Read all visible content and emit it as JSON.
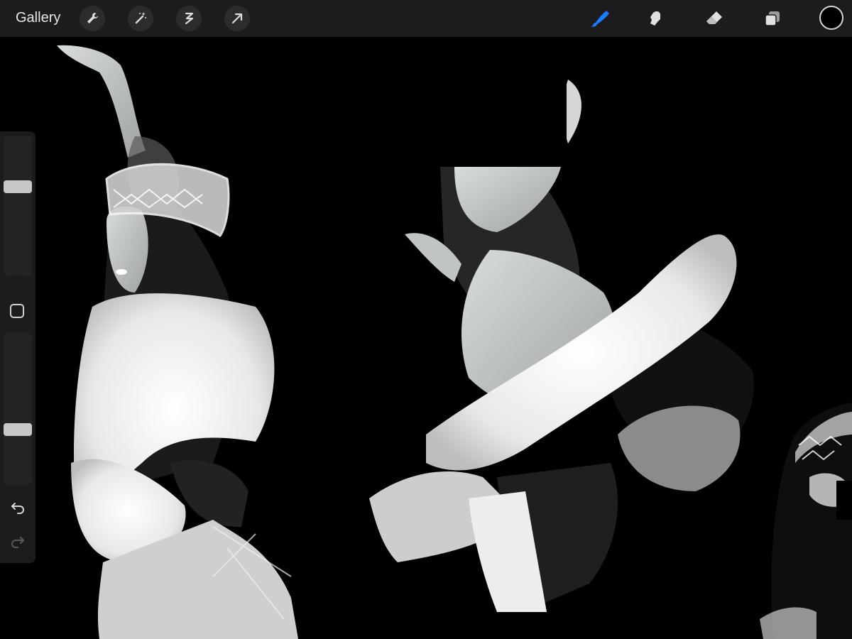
{
  "topbar": {
    "gallery_label": "Gallery",
    "left_tools": [
      {
        "name": "actions-wrench-icon"
      },
      {
        "name": "adjustments-magic-wand-icon"
      },
      {
        "name": "selection-icon"
      },
      {
        "name": "transform-arrow-icon"
      }
    ],
    "right_tools": [
      {
        "name": "brush-icon",
        "active": true
      },
      {
        "name": "smudge-icon"
      },
      {
        "name": "eraser-icon"
      },
      {
        "name": "layers-icon"
      }
    ],
    "current_color": "#000000",
    "accent_color": "#1a7cff"
  },
  "sidebar": {
    "brush_size_level": 0.65,
    "opacity_level": 0.35,
    "modify_icon": "square-modify-icon",
    "undo_icon": "undo-icon",
    "redo_icon": "redo-icon"
  }
}
